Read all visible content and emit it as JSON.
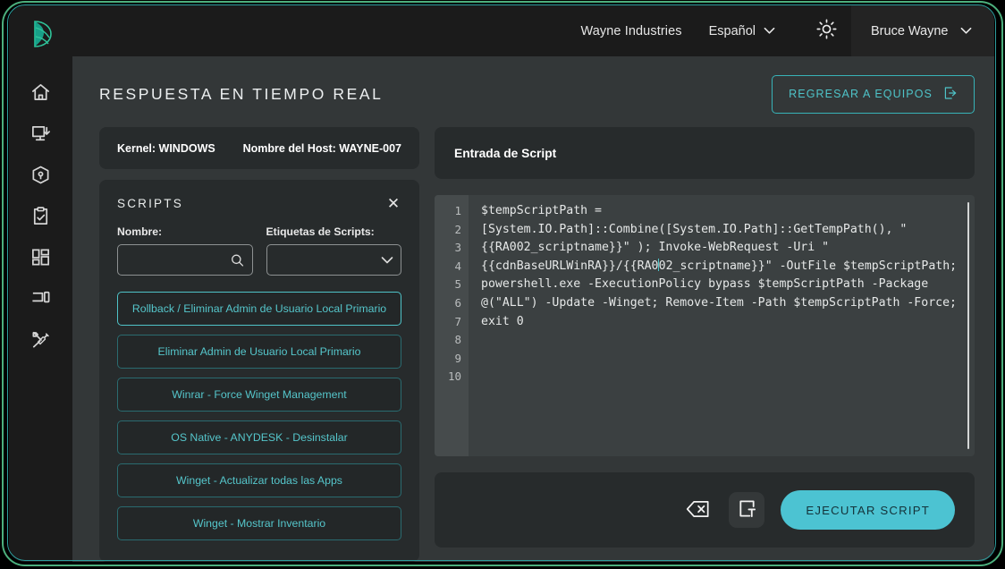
{
  "brand": {
    "logo_icon": "leaf-logo-icon",
    "accent": "#4cc3d2",
    "frame_color": "#4caf7d"
  },
  "sidebar": {
    "items": [
      {
        "icon": "home-icon",
        "name": "sidebar-item-home"
      },
      {
        "icon": "monitor-download-icon",
        "name": "sidebar-item-deploy"
      },
      {
        "icon": "package-box-icon",
        "name": "sidebar-item-packages"
      },
      {
        "icon": "clipboard-check-icon",
        "name": "sidebar-item-tasks"
      },
      {
        "icon": "dashboard-grid-icon",
        "name": "sidebar-item-dashboard"
      },
      {
        "icon": "devices-icon",
        "name": "sidebar-item-devices"
      },
      {
        "icon": "tools-icon",
        "name": "sidebar-item-tools"
      }
    ]
  },
  "topbar": {
    "tenant": "Wayne Industries",
    "language": "Español",
    "language_chevron": "⌄",
    "theme_icon": "sun-icon",
    "user": "Bruce Wayne",
    "user_chevron": "⌄"
  },
  "page": {
    "title": "RESPUESTA EN TIEMPO REAL",
    "back_button": "REGRESAR A EQUIPOS",
    "back_button_icon": "logout-arrow-icon"
  },
  "host": {
    "kernel": "Kernel: WINDOWS",
    "hostname": "Nombre del Host: WAYNE-007"
  },
  "scripts_panel": {
    "title": "SCRIPTS",
    "close_icon": "close-icon",
    "name_label": "Nombre:",
    "name_value": "",
    "name_placeholder": "",
    "name_icon": "search-icon",
    "tags_label": "Etiquetas de Scripts:",
    "tags_value": "",
    "tags_icon": "chevron-down-icon",
    "items": [
      {
        "label": "Rollback / Eliminar Admin de Usuario Local Primario",
        "active": true
      },
      {
        "label": "Eliminar Admin de Usuario Local Primario",
        "active": false
      },
      {
        "label": "Winrar - Force Winget Management",
        "active": false
      },
      {
        "label": "OS Native - ANYDESK - Desinstalar",
        "active": false
      },
      {
        "label": "Winget - Actualizar todas las Apps",
        "active": false
      },
      {
        "label": "Winget - Mostrar Inventario",
        "active": false
      }
    ]
  },
  "editor_panel": {
    "header": "Entrada de Script",
    "line_numbers": [
      "1",
      "2",
      "3",
      "4",
      "5",
      "6",
      "7",
      "8",
      "9",
      "10"
    ],
    "code_before_caret": "$tempScriptPath = [System.IO.Path]::Combine([System.IO.Path]::GetTempPath(), \"{{RA002_scriptname}}\" ); Invoke-WebRequest -Uri \"{{cdnBaseURLWinRA}}/{{RA0",
    "code_after_caret": "02_scriptname}}\" -OutFile $tempScriptPath; powershell.exe -ExecutionPolicy bypass $tempScriptPath -Package @(\"ALL\") -Update -Winget; Remove-Item -Path $tempScriptPath -Force; exit 0",
    "actions": {
      "clear_icon": "backspace-delete-icon",
      "paste_icon": "clipboard-paste-icon",
      "run_label": "EJECUTAR SCRIPT"
    }
  }
}
